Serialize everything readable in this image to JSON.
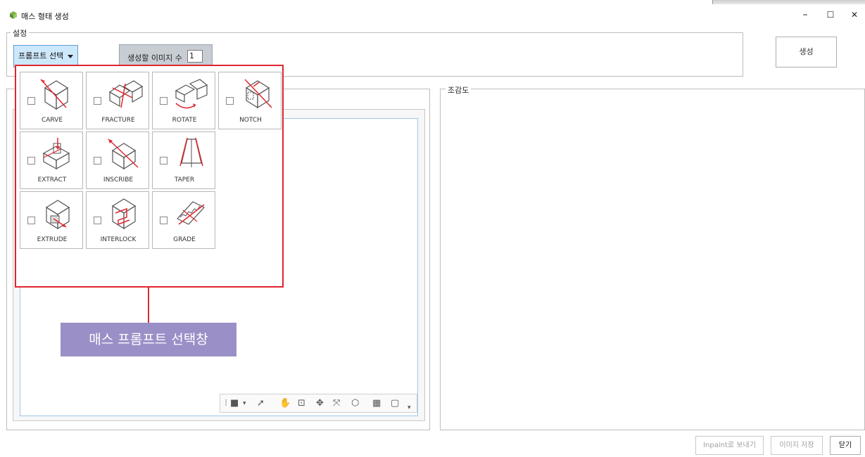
{
  "window": {
    "title": "매스 형태 생성",
    "minimize_glyph": "–",
    "maximize_glyph": "☐",
    "close_glyph": "✕"
  },
  "settings": {
    "group_label": "설정",
    "prompt_select_label": "프롬프트 선택",
    "image_count_label": "생성할 이미지 수",
    "image_count_value": "1",
    "generate_label": "생성"
  },
  "birdseye": {
    "group_label": "조감도"
  },
  "prompts": [
    {
      "label": "CARVE",
      "icon": "carve-icon"
    },
    {
      "label": "FRACTURE",
      "icon": "fracture-icon"
    },
    {
      "label": "ROTATE",
      "icon": "rotate-icon"
    },
    {
      "label": "NOTCH",
      "icon": "notch-icon"
    },
    {
      "label": "EXTRACT",
      "icon": "extract-icon"
    },
    {
      "label": "INSCRIBE",
      "icon": "inscribe-icon"
    },
    {
      "label": "TAPER",
      "icon": "taper-icon"
    },
    {
      "label": "EXTRUDE",
      "icon": "extrude-icon"
    },
    {
      "label": "INTERLOCK",
      "icon": "interlock-icon"
    },
    {
      "label": "GRADE",
      "icon": "grade-icon"
    }
  ],
  "annotation": {
    "callout": "매스 프롬프트 선택창"
  },
  "footer": {
    "send_inpaint": "Inpaint로 보내기",
    "save_image": "이미지 저장",
    "close": "닫기"
  },
  "colors": {
    "highlight_red": "#e0262e",
    "callout_purple": "#9b8fc7",
    "prompt_button_bg": "#cde8fb"
  }
}
